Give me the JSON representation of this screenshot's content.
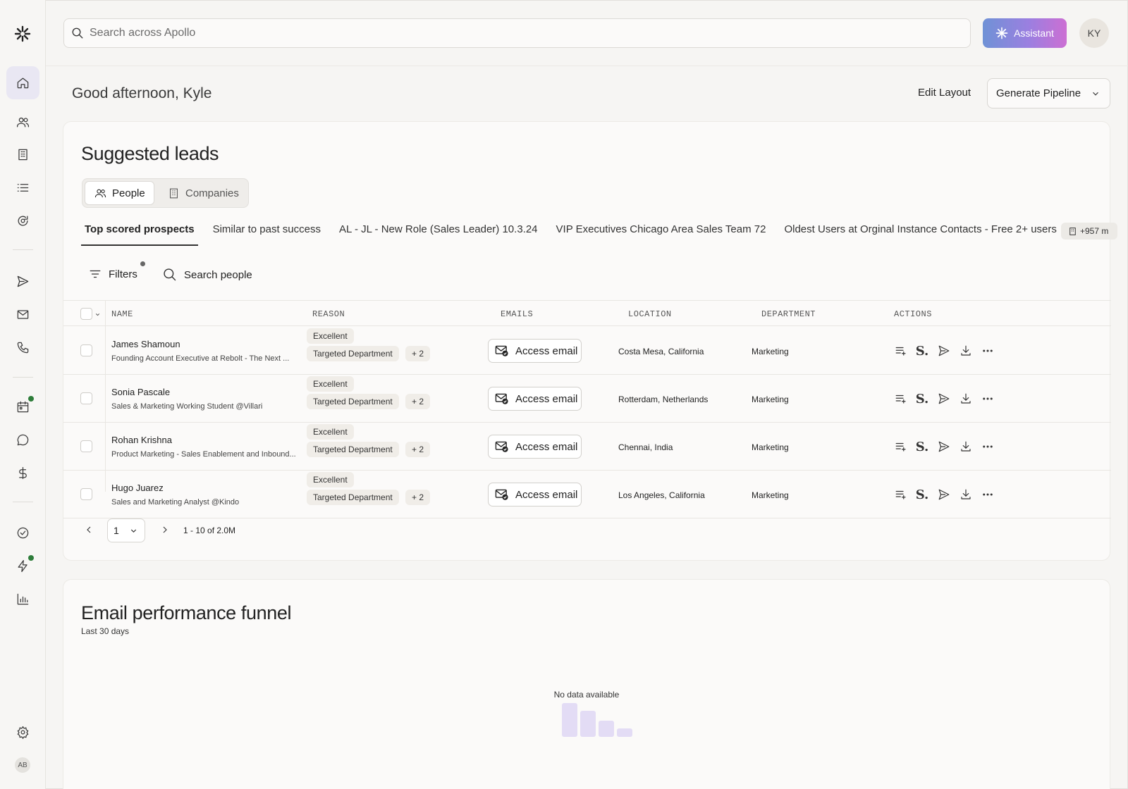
{
  "app": {
    "search_placeholder": "Search across Apollo",
    "assistant_label": "Assistant",
    "user_initials": "KY",
    "sidebar_initials": "AB",
    "accent_gradient": [
      "#6f92d6",
      "#cc6fd3"
    ],
    "status_dot_color": "#2e7d3a"
  },
  "sidebar": {
    "items": [
      {
        "icon": "home-icon",
        "active": true
      },
      {
        "icon": "people-icon"
      },
      {
        "icon": "building-icon"
      },
      {
        "icon": "list-icon"
      },
      {
        "icon": "refresh-search-icon"
      },
      {
        "icon": "send-icon"
      },
      {
        "icon": "mail-icon"
      },
      {
        "icon": "phone-icon"
      },
      {
        "icon": "calendar-icon",
        "badge": true
      },
      {
        "icon": "chat-icon"
      },
      {
        "icon": "dollar-icon"
      },
      {
        "icon": "check-circle-icon"
      },
      {
        "icon": "lightning-icon",
        "badge": true
      },
      {
        "icon": "bar-chart-icon"
      },
      {
        "icon": "settings-icon"
      }
    ]
  },
  "header": {
    "greeting": "Good afternoon, Kyle",
    "edit_layout": "Edit Layout",
    "generate_pipeline": "Generate Pipeline"
  },
  "leads": {
    "title": "Suggested leads",
    "segments": [
      "People",
      "Companies"
    ],
    "tabs": [
      "Top scored prospects",
      "Similar to past success",
      "AL - JL - New Role (Sales Leader) 10.3.24",
      "VIP Executives Chicago Area Sales Team 72",
      "Oldest Users at Orginal Instance Contacts - Free 2+ users"
    ],
    "tab_chip": "+957 m",
    "filters_label": "Filters",
    "search_people_label": "Search people",
    "columns": [
      "NAME",
      "REASON",
      "EMAILS",
      "LOCATION",
      "DEPARTMENT",
      "ACTIONS"
    ],
    "access_email_label": "Access email",
    "rows": [
      {
        "name": "James Shamoun",
        "title": "Founding Account Executive at Rebolt - The Next ...",
        "reason1": "Excellent",
        "reason2": "Targeted Department",
        "more": "+ 2",
        "location": "Costa Mesa, California",
        "department": "Marketing"
      },
      {
        "name": "Sonia Pascale",
        "title": "Sales & Marketing Working Student @Villari",
        "reason1": "Excellent",
        "reason2": "Targeted Department",
        "more": "+ 2",
        "location": "Rotterdam, Netherlands",
        "department": "Marketing"
      },
      {
        "name": "Rohan Krishna",
        "title": "Product Marketing - Sales Enablement and Inbound...",
        "reason1": "Excellent",
        "reason2": "Targeted Department",
        "more": "+ 2",
        "location": "Chennai, India",
        "department": "Marketing"
      },
      {
        "name": "Hugo Juarez",
        "title": "Sales and Marketing Analyst @Kindo",
        "reason1": "Excellent",
        "reason2": "Targeted Department",
        "more": "+ 2",
        "location": "Los Angeles, California",
        "department": "Marketing"
      }
    ],
    "page_value": "1",
    "pager_text": "1 - 10 of 2.0M"
  },
  "funnel": {
    "title": "Email performance funnel",
    "subtitle": "Last 30 days",
    "empty_text": "No data available"
  }
}
